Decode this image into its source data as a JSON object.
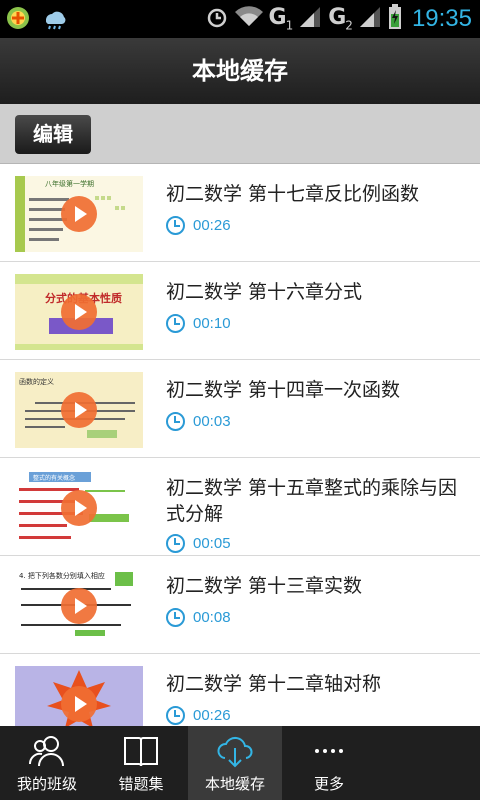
{
  "status_bar": {
    "network_1": "G",
    "network_1_sub": "1",
    "network_2": "G",
    "network_2_sub": "2",
    "time": "19:35"
  },
  "header": {
    "title": "本地缓存"
  },
  "toolbar": {
    "edit_label": "编辑"
  },
  "videos": [
    {
      "title": "初二数学 第十七章反比例函数",
      "duration": "00:26",
      "thumb_text": "八年级第一学期"
    },
    {
      "title": "初二数学 第十六章分式",
      "duration": "00:10",
      "thumb_text": "分式的基本性质"
    },
    {
      "title": "初二数学 第十四章一次函数",
      "duration": "00:03",
      "thumb_text": "函数的定义"
    },
    {
      "title": "初二数学 第十五章整式的乘除与因式分解",
      "duration": "00:05",
      "thumb_text": "整式的有关概念"
    },
    {
      "title": "初二数学 第十三章实数",
      "duration": "00:08",
      "thumb_text": "4. 把下列各数分别填入相应"
    },
    {
      "title": "初二数学 第十二章轴对称",
      "duration": "00:26",
      "thumb_text": ""
    }
  ],
  "bottom_nav": [
    {
      "label": "我的班级",
      "icon": "users-icon"
    },
    {
      "label": "错题集",
      "icon": "book-icon"
    },
    {
      "label": "本地缓存",
      "icon": "cloud-download-icon"
    },
    {
      "label": "更多",
      "icon": "more-icon"
    }
  ],
  "colors": {
    "accent": "#2a9ad6",
    "play": "#f06e32",
    "time": "#33b5e5"
  }
}
